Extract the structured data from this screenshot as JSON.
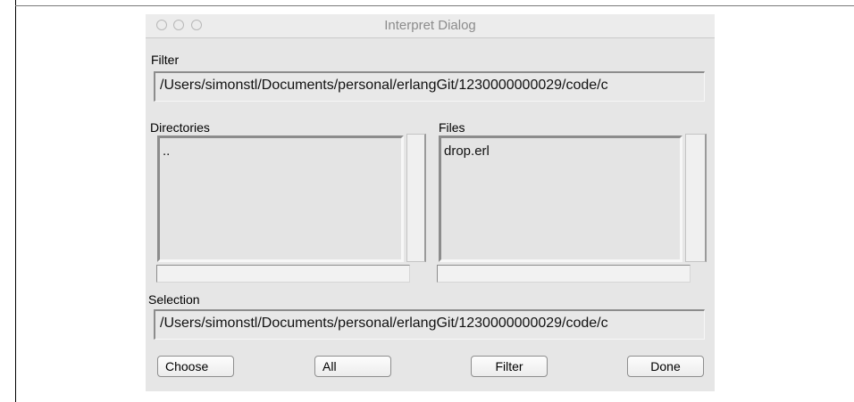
{
  "window": {
    "title": "Interpret Dialog"
  },
  "filter": {
    "label": "Filter",
    "value": "/Users/simonstl/Documents/personal/erlangGit/1230000000029/code/c"
  },
  "directories": {
    "label": "Directories",
    "items": [
      ".."
    ]
  },
  "files": {
    "label": "Files",
    "items": [
      "drop.erl"
    ]
  },
  "selection": {
    "label": "Selection",
    "value": "/Users/simonstl/Documents/personal/erlangGit/1230000000029/code/c"
  },
  "buttons": {
    "choose": "Choose",
    "all": "All",
    "filter": "Filter",
    "done": "Done"
  }
}
